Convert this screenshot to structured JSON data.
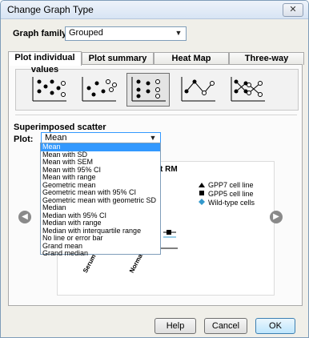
{
  "window": {
    "title": "Change Graph Type",
    "close_glyph": "✕"
  },
  "family": {
    "label": "Graph family:",
    "value": "Grouped"
  },
  "tabs": [
    {
      "label": "Plot individual values"
    },
    {
      "label": "Plot summary data"
    },
    {
      "label": "Heat Map"
    },
    {
      "label": "Three-way"
    }
  ],
  "section": {
    "label": "Superimposed scatter"
  },
  "plot": {
    "label": "Plot:",
    "value": "Mean",
    "options": [
      "Mean",
      "Mean with SD",
      "Mean with SEM",
      "Mean with 95% CI",
      "Mean with range",
      "Geometric mean",
      "Geometric mean with 95% CI",
      "Geometric mean with geometric SD",
      "Median",
      "Median with 95% CI",
      "Median with range",
      "Median with interquartile range",
      "No line or error bar",
      "Grand mean",
      "Grand median"
    ],
    "selected_index": 0
  },
  "preview": {
    "title_fragment": "t RM",
    "legend": [
      {
        "label": "GPP7 cell line",
        "marker": "triangle",
        "color": "#000000"
      },
      {
        "label": "GPP5 cell line",
        "marker": "square",
        "color": "#000000"
      },
      {
        "label": "Wild-type cells",
        "marker": "diamond",
        "color": "#3399cc"
      }
    ],
    "x_labels": [
      "Serum starved",
      "Normal culture"
    ]
  },
  "nav": {
    "prev_glyph": "◀",
    "next_glyph": "▶"
  },
  "buttons": {
    "help": "Help",
    "cancel": "Cancel",
    "ok": "OK"
  },
  "colors": {
    "selection": "#3399ff",
    "title_bar": "#d7e4f4"
  }
}
